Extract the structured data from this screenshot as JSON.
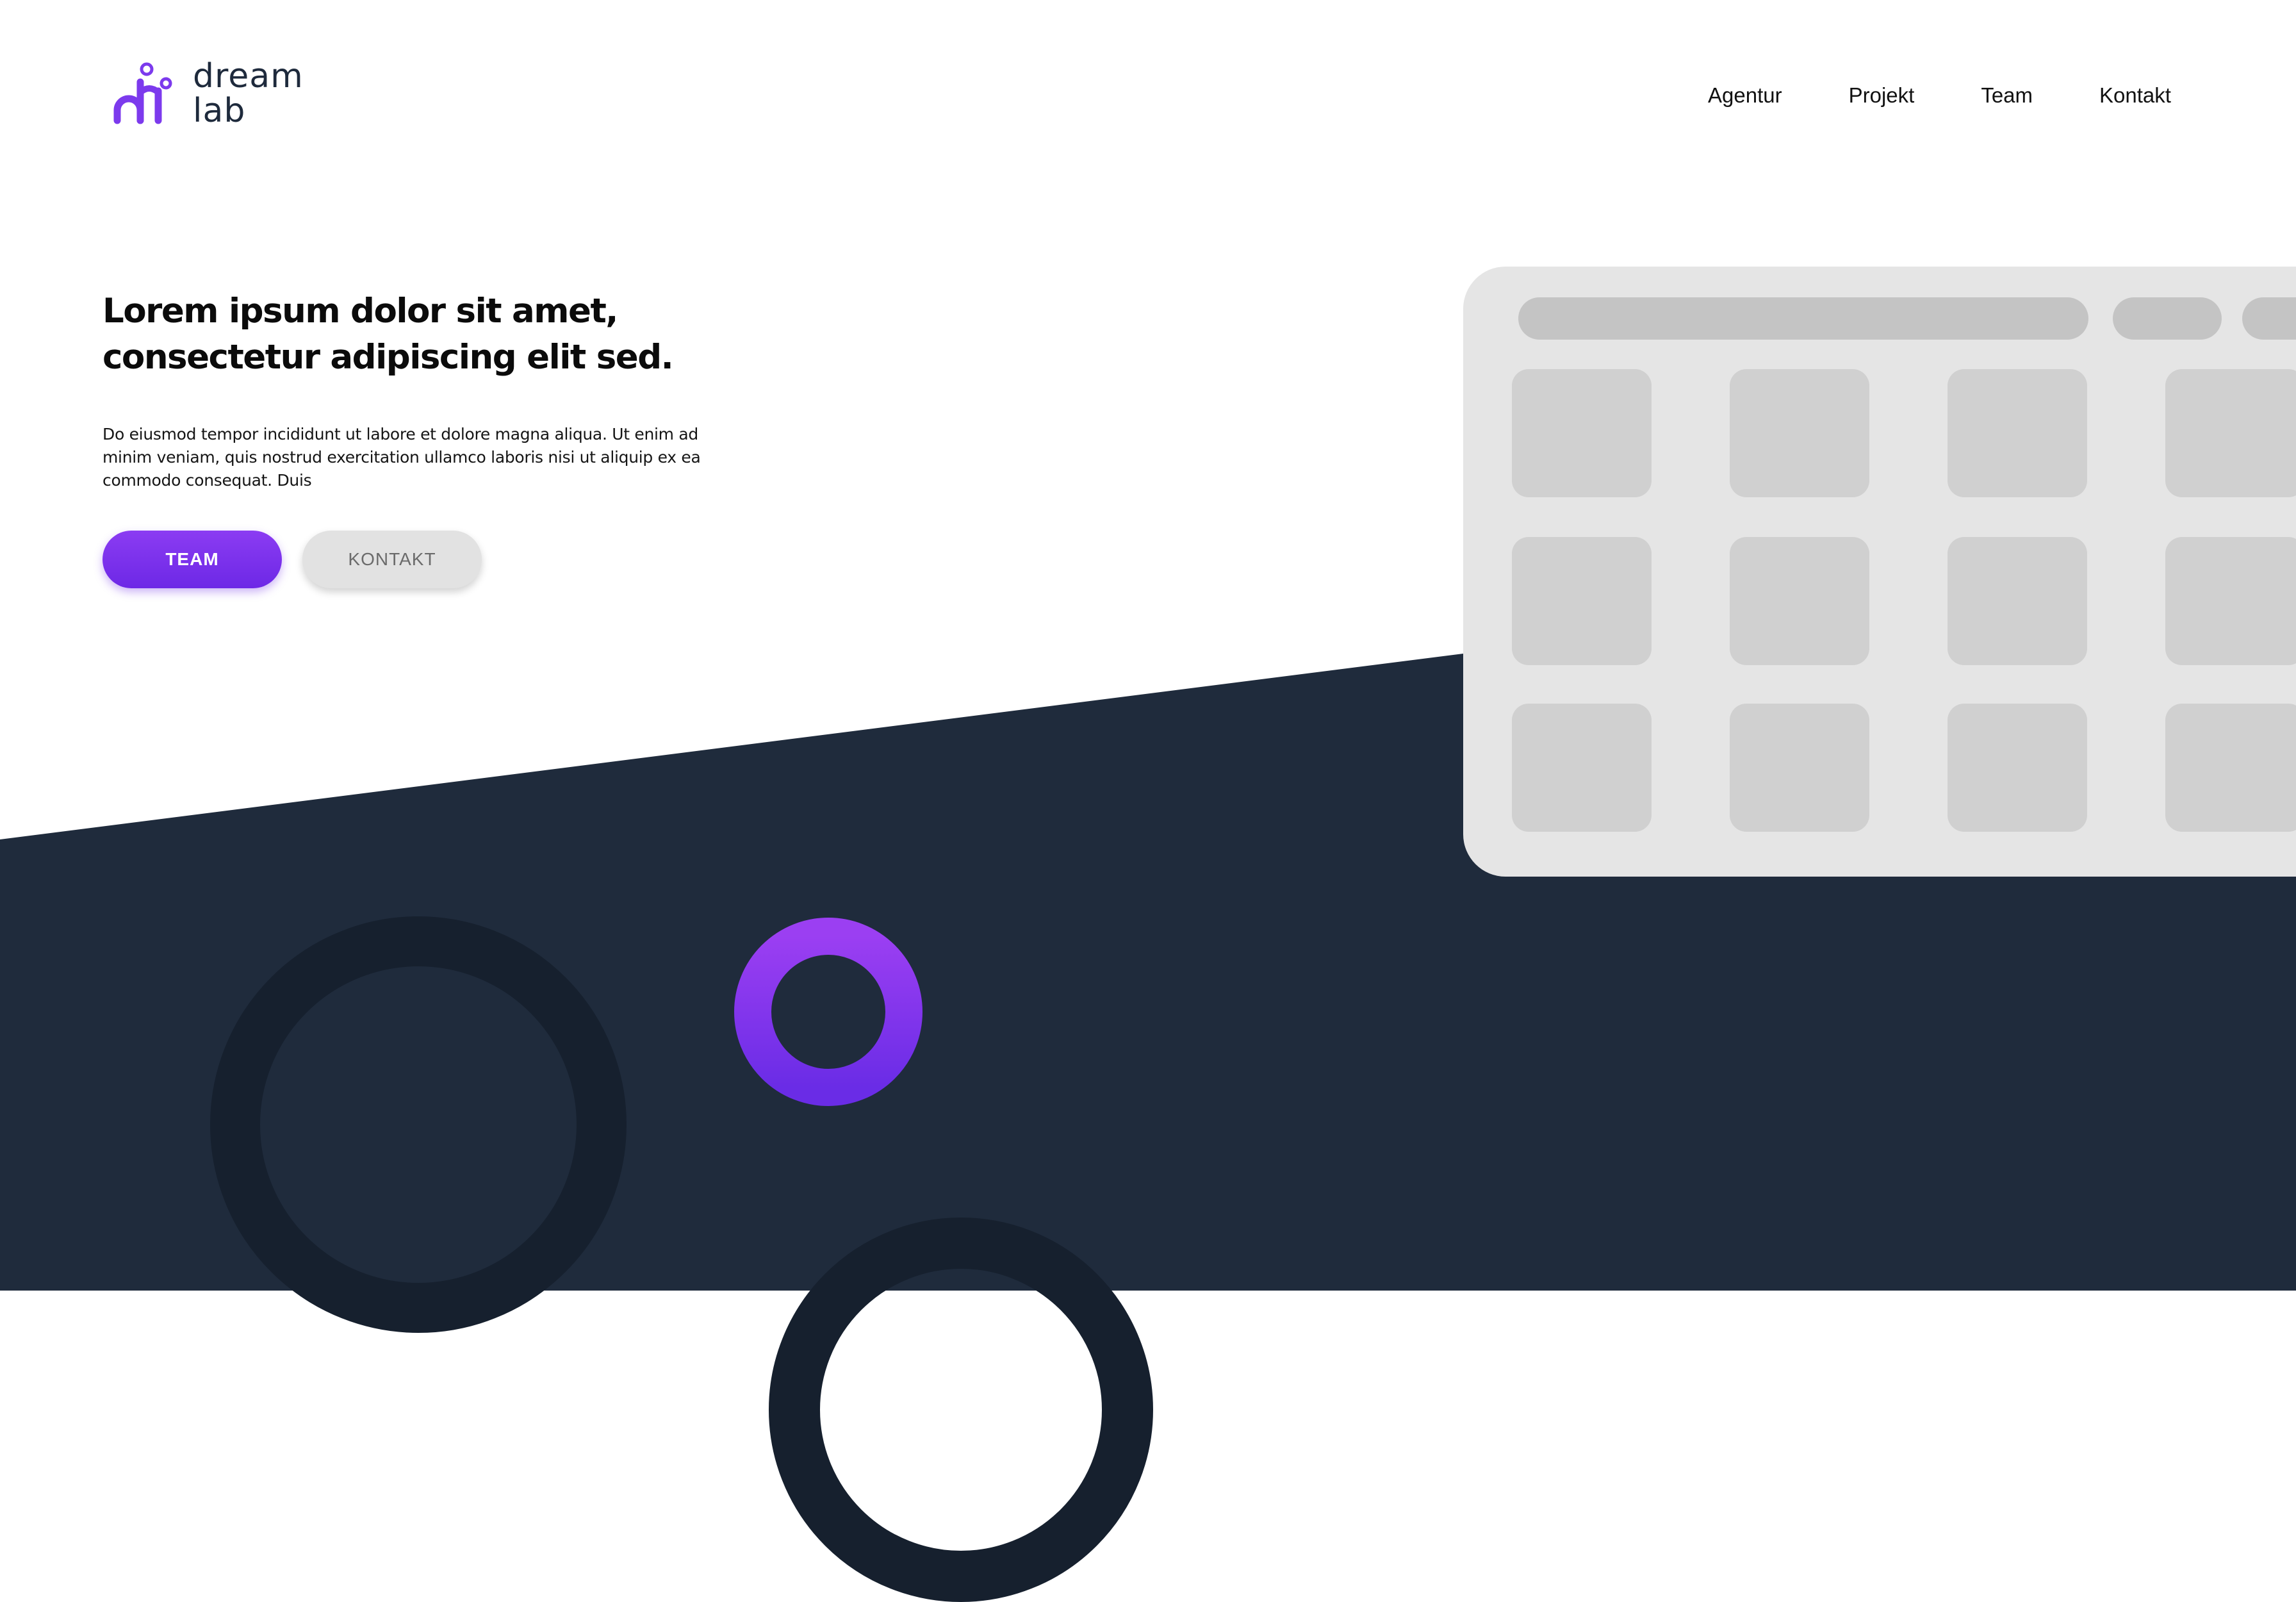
{
  "brand": {
    "logo_line1": "dream",
    "logo_line2": "lab",
    "accent_color": "#7c3aed",
    "text_color": "#1e2a3c"
  },
  "nav": {
    "items": [
      {
        "label": "Agentur"
      },
      {
        "label": "Projekt"
      },
      {
        "label": "Team"
      },
      {
        "label": "Kontakt"
      }
    ]
  },
  "hero": {
    "headline_line1": "Lorem ipsum dolor sit amet,",
    "headline_line2": "consectetur adipiscing elit sed.",
    "body": "Do eiusmod tempor incididunt ut labore et dolore magna aliqua. Ut enim ad minim veniam, quis nostrud exercitation ullamco laboris nisi ut aliquip ex ea commodo consequat. Duis",
    "primary_button": "TEAM",
    "secondary_button": "KONTAKT"
  },
  "colors": {
    "dark_background": "#1f2b3c",
    "dark_ring": "#16202e",
    "purple_gradient_start": "#9b3ff2",
    "purple_gradient_end": "#6a2ce6",
    "panel_background": "#e5e5e5",
    "placeholder": "#d0d0d0"
  }
}
